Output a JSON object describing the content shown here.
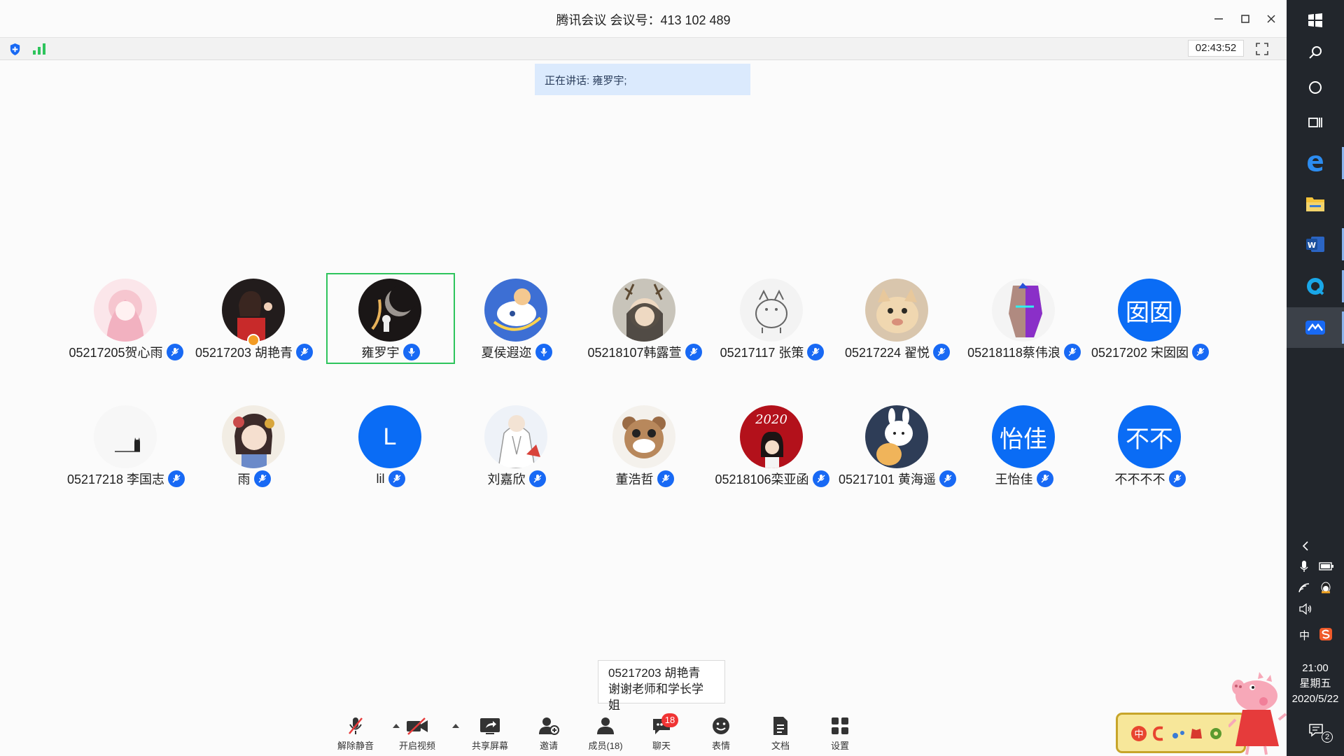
{
  "window": {
    "title": "腾讯会议 会议号：413 102 489",
    "timer": "02:43:52",
    "speaking": "正在讲话: 雍罗宇;"
  },
  "icons": {
    "minimize": "minimize-icon",
    "maximize": "maximize-icon",
    "close": "close-icon",
    "security": "shield-icon",
    "signal": "signal-icon",
    "fullscreen": "fullscreen-icon"
  },
  "participants": [
    {
      "name": "05217205贺心雨",
      "avatar": "pink-anime-girl"
    },
    {
      "name": "05217203 胡艳青",
      "avatar": "photo-girl-waving",
      "host": true
    },
    {
      "name": "雍罗宇",
      "avatar": "astronaut-moon",
      "active": true
    },
    {
      "name": "夏侯遐迩",
      "avatar": "blue-bird-illustration"
    },
    {
      "name": "05218107韩露萱",
      "avatar": "antlered-anime-girl"
    },
    {
      "name": "05217117 张策",
      "avatar": "white-cat-sketch"
    },
    {
      "name": "05217224 翟悦",
      "avatar": "orange-cat"
    },
    {
      "name": "05218118蔡伟浪",
      "avatar": "neon-face"
    },
    {
      "name": "05217202 宋囡囡",
      "avatar_text": "囡囡"
    },
    {
      "name": "05217218 李国志",
      "avatar": "black-cat-on-line"
    },
    {
      "name": "雨",
      "avatar": "chinese-style-girl"
    },
    {
      "name": "lil",
      "avatar_text": "L"
    },
    {
      "name": "刘嘉欣",
      "avatar": "white-shirt-boy"
    },
    {
      "name": "董浩哲",
      "avatar": "masked-bear"
    },
    {
      "name": "05218106栾亚函",
      "avatar": "red-2020-girl"
    },
    {
      "name": "05217101 黄海遥",
      "avatar": "bunny-and-dog"
    },
    {
      "name": "王怡佳",
      "avatar_text": "怡佳"
    },
    {
      "name": "不不不不",
      "avatar_text": "不不"
    }
  ],
  "chat_popup": {
    "sender": "05217203 胡艳青",
    "message": "谢谢老师和学长学姐"
  },
  "toolbar": [
    {
      "label": "解除静音",
      "icon": "muted-mic-icon"
    },
    {
      "label": "开启视频",
      "icon": "video-off-icon"
    },
    {
      "label": "共享屏幕",
      "icon": "share-screen-icon"
    },
    {
      "label": "邀请",
      "icon": "invite-icon"
    },
    {
      "label": "成员(18)",
      "icon": "members-icon"
    },
    {
      "label": "聊天",
      "icon": "chat-icon",
      "badge": "18"
    },
    {
      "label": "表情",
      "icon": "emoji-icon"
    },
    {
      "label": "文档",
      "icon": "document-icon"
    },
    {
      "label": "设置",
      "icon": "settings-icon"
    }
  ],
  "taskbar": {
    "apps": [
      "windows-start-icon",
      "search-icon",
      "cortana-icon",
      "task-view-icon",
      "edge-icon",
      "file-explorer-icon",
      "word-icon",
      "qq-browser-icon",
      "tencent-meeting-icon"
    ],
    "tray": {
      "ime": "中",
      "time": "21:00",
      "weekday": "星期五",
      "date": "2020/5/22",
      "notifications": "2"
    }
  },
  "colors": {
    "accent": "#1869f4",
    "active_border": "#2ec45c",
    "speaking_bg": "#dbeafd",
    "badge": "#f03434",
    "taskbar": "#22262c"
  }
}
